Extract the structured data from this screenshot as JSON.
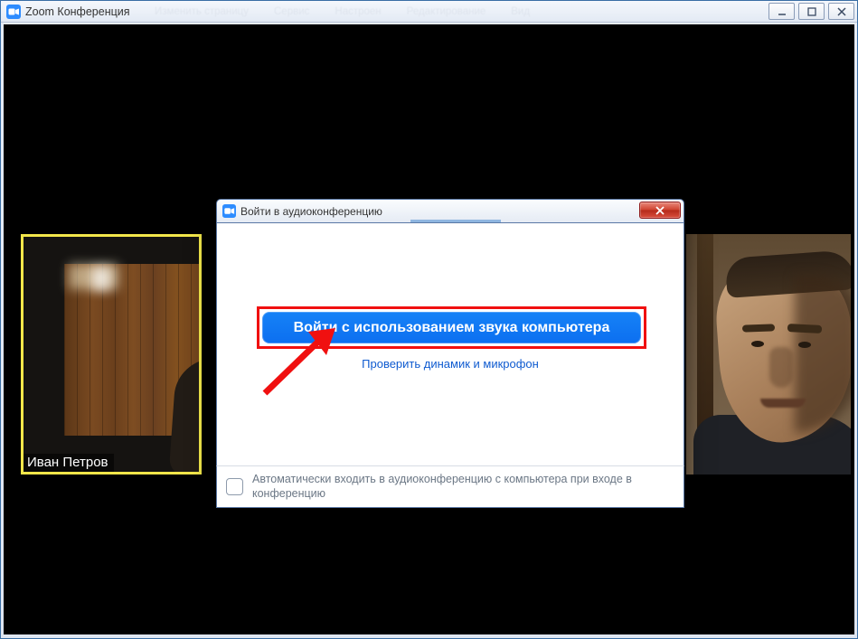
{
  "titlebar": {
    "app_name": "Zoom Конференция",
    "menu_items": [
      "Изменить страницу",
      "Сервис",
      "Настроен",
      "Редактирование",
      "Вид"
    ]
  },
  "window_controls": {
    "minimize_name": "minimize-icon",
    "maximize_name": "maximize-icon",
    "close_name": "close-icon"
  },
  "participant": {
    "name": "Иван Петров"
  },
  "dialog": {
    "title": "Войти в аудиоконференцию",
    "primary_button": "Войти с использованием звука компьютера",
    "test_link": "Проверить динамик и микрофон",
    "checkbox_label": "Автоматически входить в аудиоконференцию с компьютера при входе в конференцию"
  },
  "icons": {
    "app_icon_name": "zoom-camera-icon",
    "dialog_close_name": "close-icon"
  },
  "colors": {
    "accent_blue": "#0e71f0",
    "highlight_yellow": "#f2e64a",
    "annotation_red": "#f01010"
  }
}
